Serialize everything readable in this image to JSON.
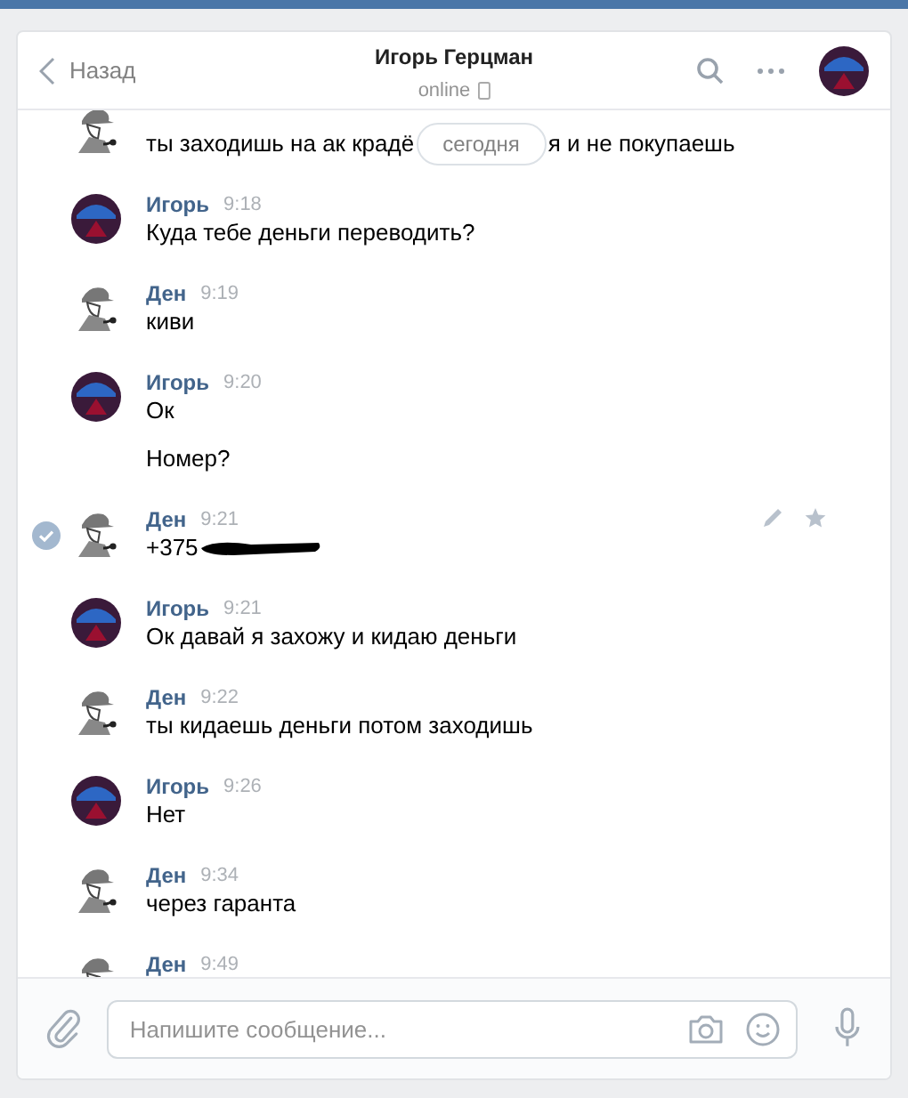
{
  "header": {
    "back_label": "Назад",
    "title": "Игорь Герцман",
    "status": "online"
  },
  "date_pill": "сегодня",
  "messages": [
    {
      "kind": "den",
      "selected": false,
      "text_parts": [
        "ты заходишь на ак крадё",
        "я и не покупаешь"
      ]
    },
    {
      "author": "Игорь",
      "time": "9:18",
      "kind": "igor",
      "selected": false,
      "texts": [
        "Куда тебе деньги переводить?"
      ]
    },
    {
      "author": "Ден",
      "time": "9:19",
      "kind": "den",
      "selected": false,
      "texts": [
        "киви"
      ]
    },
    {
      "author": "Игорь",
      "time": "9:20",
      "kind": "igor",
      "selected": false,
      "texts": [
        "Ок",
        "Номер?"
      ]
    },
    {
      "author": "Ден",
      "time": "9:21",
      "kind": "den",
      "selected": true,
      "redacted": true,
      "texts": [
        "+375"
      ]
    },
    {
      "author": "Игорь",
      "time": "9:21",
      "kind": "igor",
      "selected": false,
      "texts": [
        "Ок давай я захожу и кидаю деньги"
      ]
    },
    {
      "author": "Ден",
      "time": "9:22",
      "kind": "den",
      "selected": false,
      "texts": [
        "ты кидаешь деньги потом заходишь"
      ]
    },
    {
      "author": "Игорь",
      "time": "9:26",
      "kind": "igor",
      "selected": false,
      "texts": [
        "Нет"
      ]
    },
    {
      "author": "Ден",
      "time": "9:34",
      "kind": "den",
      "selected": false,
      "texts": [
        "через гаранта"
      ]
    },
    {
      "author": "Ден",
      "time": "9:49",
      "kind": "den",
      "selected": false
    }
  ],
  "composer": {
    "placeholder": "Напишите сообщение..."
  }
}
